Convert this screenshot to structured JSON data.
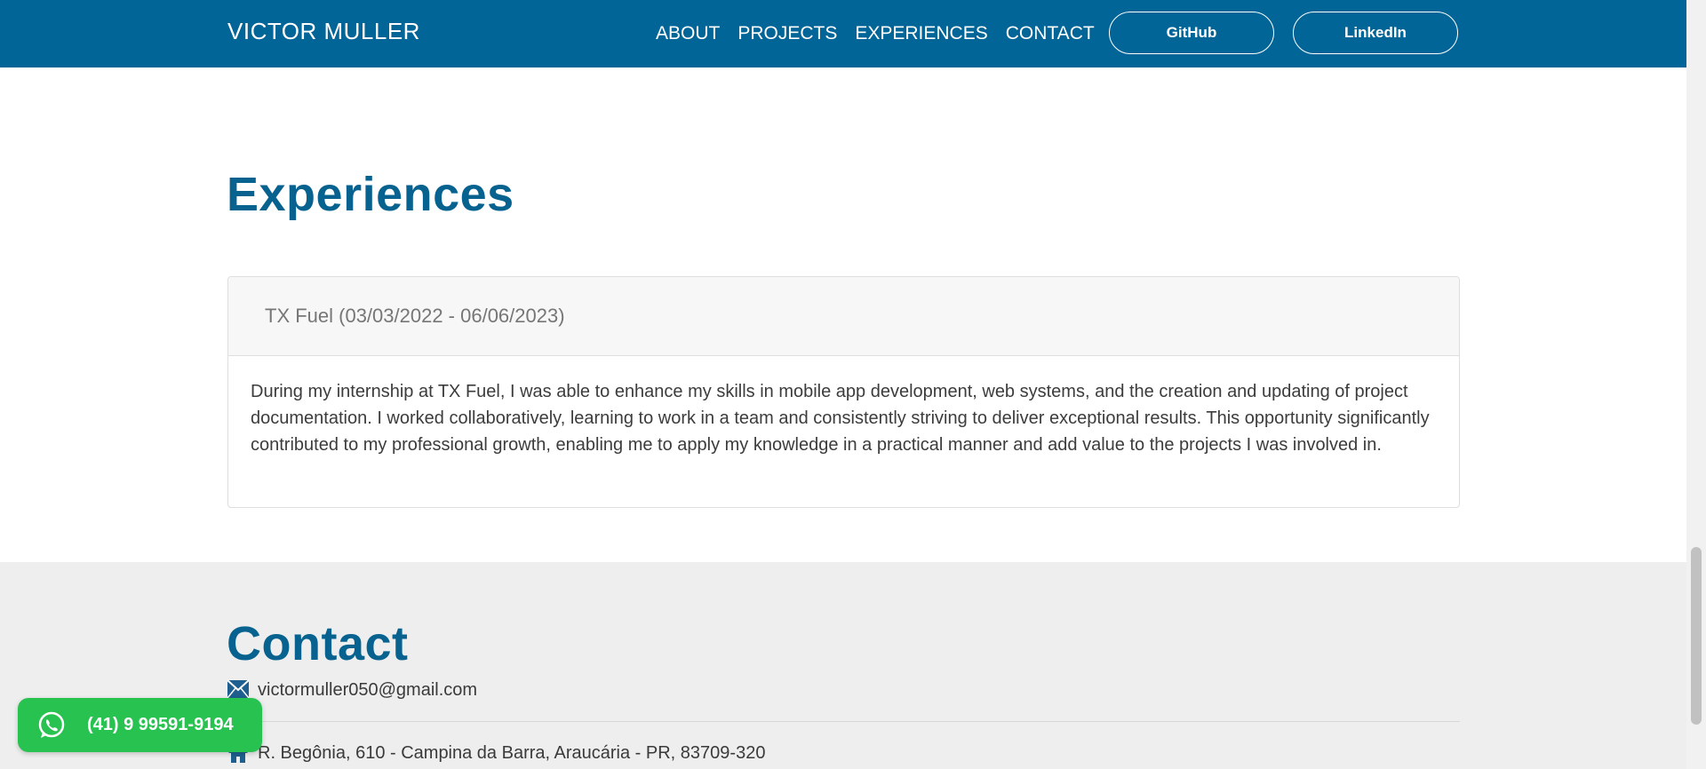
{
  "navbar": {
    "brand": "VICTOR MULLER",
    "links": [
      "ABOUT",
      "PROJECTS",
      "EXPERIENCES",
      "CONTACT"
    ],
    "github_label": "GitHub",
    "linkedin_label": "LinkedIn"
  },
  "experiences": {
    "title": "Experiences",
    "items": [
      {
        "header": "TX Fuel (03/03/2022 - 06/06/2023)",
        "body": "During my internship at TX Fuel, I was able to enhance my skills in mobile app development, web systems, and the creation and updating of project documentation. I worked collaboratively, learning to work in a team and consistently striving to deliver exceptional results. This opportunity significantly contributed to my professional growth, enabling me to apply my knowledge in a practical manner and add value to the projects I was involved in."
      }
    ]
  },
  "contact": {
    "title": "Contact",
    "email": "victormuller050@gmail.com",
    "address": "R. Begônia, 610 - Campina da Barra, Araucária - PR, 83709-320"
  },
  "whatsapp": {
    "label": "(41) 9 99591-9194"
  },
  "colors": {
    "primary": "#026597",
    "heading": "#07628f",
    "whatsapp": "#27c250"
  },
  "icons": {
    "email": "envelope-icon",
    "address": "house-icon",
    "whatsapp": "whatsapp-icon"
  }
}
